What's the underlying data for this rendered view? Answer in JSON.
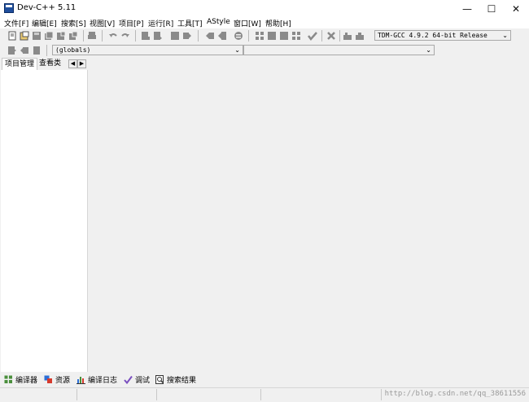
{
  "window": {
    "title": "Dev-C++ 5.11"
  },
  "menu": [
    "文件[F]",
    "编辑[E]",
    "搜索[S]",
    "视图[V]",
    "项目[P]",
    "运行[R]",
    "工具[T]",
    "AStyle",
    "窗口[W]",
    "帮助[H]"
  ],
  "toolbar": {
    "compiler_select": "TDM-GCC 4.9.2 64-bit Release"
  },
  "class_toolbar": {
    "scope_select": "(globals)",
    "member_select": ""
  },
  "side_tabs": [
    "项目管理",
    "查看类"
  ],
  "bottom_tabs": [
    "编译器",
    "资源",
    "编译日志",
    "调试",
    "搜索结果"
  ],
  "status": {
    "watermark": "http://blog.csdn.net/qq_38611556"
  },
  "colors": {
    "window_bg": "#f0f0f0",
    "panel_bg": "#ffffff",
    "icon_gray": "#8a8a8a"
  }
}
